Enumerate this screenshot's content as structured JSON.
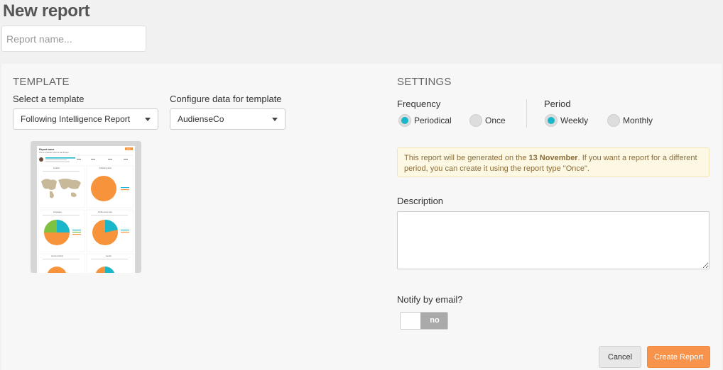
{
  "header": {
    "title": "New report"
  },
  "report_name": {
    "value": "",
    "placeholder": "Report name..."
  },
  "template": {
    "heading": "TEMPLATE",
    "select_label": "Select a template",
    "select_value": "Following Intelligence Report",
    "config_label": "Configure data for template",
    "config_value": "AudienseCo",
    "preview": {
      "title": "Report name",
      "subtitle": "This is a periodic report for last 30 days",
      "button": "SEND",
      "cards": [
        "Location",
        "Following Users",
        "Languages",
        "Profile source type",
        "Account Activity",
        "Gender"
      ],
      "colors": {
        "orange": "#f7933a",
        "teal": "#1ab6c9",
        "green": "#7ec242",
        "map": "#c9b99b"
      }
    }
  },
  "settings": {
    "heading": "SETTINGS",
    "frequency": {
      "label": "Frequency",
      "options": [
        "Periodical",
        "Once"
      ],
      "selected": "Periodical"
    },
    "period": {
      "label": "Period",
      "options": [
        "Weekly",
        "Monthly"
      ],
      "selected": "Weekly"
    },
    "notice": {
      "part1": "This report will be generated on the ",
      "date": "13 November",
      "part2": ". If you want a report for a different period, you can create it using the report type \"Once\"."
    },
    "description": {
      "label": "Description",
      "value": ""
    },
    "notify": {
      "label": "Notify by email?",
      "toggle_text": "no",
      "enabled": false
    }
  },
  "actions": {
    "cancel": "Cancel",
    "create": "Create Report"
  },
  "colors": {
    "accent": "#f7934a",
    "radio": "#19b5c8",
    "notice_bg": "#fcf8e3",
    "notice_text": "#8a6d3b"
  }
}
